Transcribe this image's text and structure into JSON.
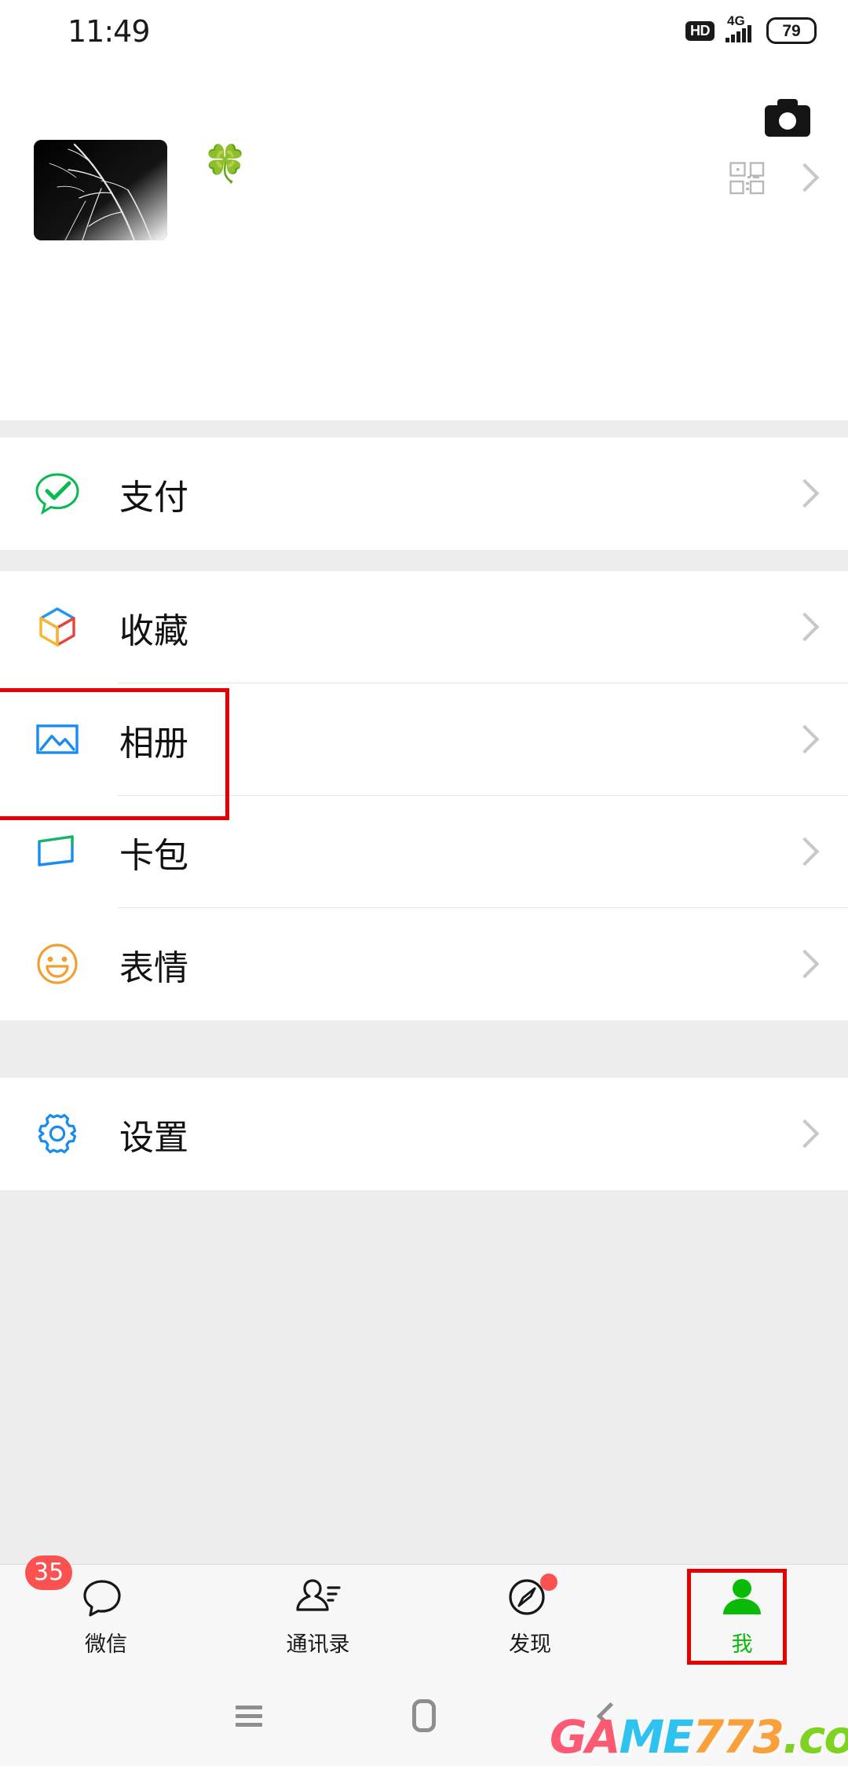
{
  "status_bar": {
    "time": "11:49",
    "hd_label": "HD",
    "network": "4G",
    "battery_level": "79"
  },
  "header": {
    "camera_icon": "camera-icon",
    "profile": {
      "name": "🍀",
      "avatar_alt": "dark tree branches photo",
      "qr_icon": "qr-code-icon",
      "chevron": "chevron-right-icon"
    }
  },
  "sections": [
    {
      "id": "pay",
      "items": [
        {
          "label": "支付",
          "icon": "pay-icon",
          "icon_color": "#09bb07",
          "chevron": "chevron-right-icon"
        }
      ]
    },
    {
      "id": "services",
      "items": [
        {
          "label": "收藏",
          "icon": "favorites-cube-icon",
          "icon_color": "#1a8cf0",
          "chevron": "chevron-right-icon"
        },
        {
          "label": "相册",
          "icon": "album-photo-icon",
          "icon_color": "#1a8cf0",
          "chevron": "chevron-right-icon"
        },
        {
          "label": "卡包",
          "icon": "cards-wallet-icon",
          "icon_color": "#1a8cf0",
          "chevron": "chevron-right-icon"
        },
        {
          "label": "表情",
          "icon": "sticker-smiley-icon",
          "icon_color": "#f0a030",
          "chevron": "chevron-right-icon"
        }
      ]
    },
    {
      "id": "settings",
      "items": [
        {
          "label": "设置",
          "icon": "settings-gear-icon",
          "icon_color": "#1a8cf0",
          "chevron": "chevron-right-icon"
        }
      ]
    }
  ],
  "tabbar": {
    "tabs": [
      {
        "label": "微信",
        "icon": "chat-bubble-icon",
        "badge": "35",
        "active": false
      },
      {
        "label": "通讯录",
        "icon": "contacts-icon",
        "badge": "",
        "active": false
      },
      {
        "label": "发现",
        "icon": "compass-icon",
        "badge": "",
        "dot": true,
        "active": false
      },
      {
        "label": "我",
        "icon": "person-icon",
        "badge": "",
        "active": true
      }
    ],
    "active_color": "#09bb07",
    "badge_color": "#fa5151"
  },
  "navbar": {
    "recents_icon": "menu-recents-icon",
    "home_icon": "home-square-icon",
    "back_icon": "back-chevron-icon"
  },
  "watermark": {
    "part1": "GA",
    "part2": "ME",
    "part3": "773",
    "part4": ".com",
    "color1": "#fb5a72",
    "color2": "#2ec2f0",
    "color3": "#f9a03a",
    "color4": "#7ed321"
  },
  "annotations": [
    {
      "name": "album-highlight",
      "target": "相册"
    },
    {
      "name": "me-tab-highlight",
      "target": "我"
    }
  ]
}
